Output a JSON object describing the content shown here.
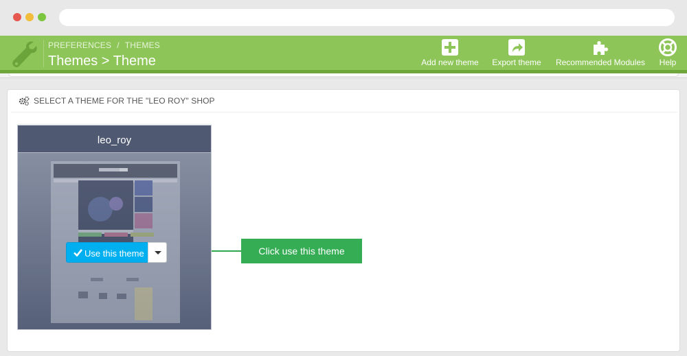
{
  "toolbar": {
    "breadcrumb": [
      "PREFERENCES",
      "THEMES"
    ],
    "breadcrumb_separator": "/",
    "title": "Themes > Theme",
    "buttons": [
      {
        "label": "Add new theme",
        "icon": "plus-square-icon"
      },
      {
        "label": "Export theme",
        "icon": "share-icon"
      },
      {
        "label": "Recommended Modules",
        "icon": "puzzle-icon"
      },
      {
        "label": "Help",
        "icon": "lifebuoy-icon"
      }
    ],
    "colors": {
      "bar": "#8dc558",
      "bar_shadow": "#6ea63c"
    }
  },
  "panel": {
    "heading": "SELECT A THEME FOR THE \"LEO ROY\" SHOP",
    "heading_icon": "gears-icon"
  },
  "theme_card": {
    "name": "leo_roy",
    "use_button_label": "Use this theme",
    "use_button_icon": "check-icon",
    "dropdown_icon": "caret-down-icon",
    "accent": "#00aff0"
  },
  "callout": {
    "text": "Click use this theme",
    "color": "#35ad55"
  }
}
